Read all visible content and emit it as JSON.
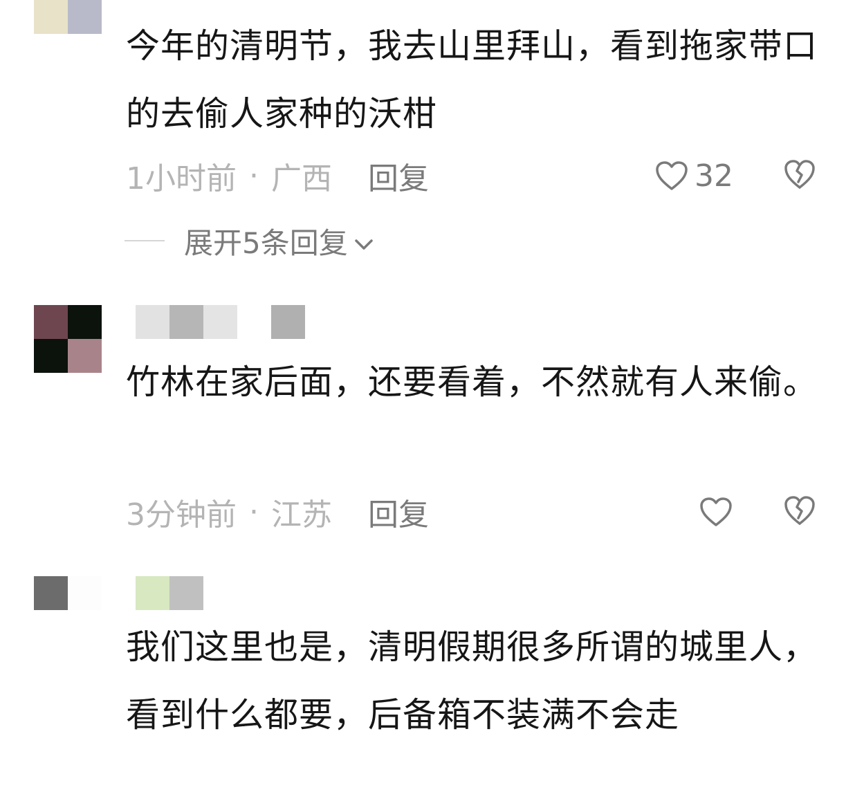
{
  "comments": [
    {
      "text": "今年的清明节，我去山里拜山，看到拖家带口的去偷人家种的沃柑",
      "time": "1小时前",
      "location": "广西",
      "reply_label": "回复",
      "like_count": "32",
      "expand_replies": "展开5条回复",
      "avatar_colors": [
        "#e8e2c8",
        "#b8bac9"
      ]
    },
    {
      "text": "竹林在家后面，还要看着，不然就有人来偷。",
      "time": "3分钟前",
      "location": "江苏",
      "reply_label": "回复",
      "like_count": "",
      "avatar_colors": [
        "#6e4650",
        "#0c120c",
        "#0c120c",
        "#a8848a"
      ],
      "username_colors": [
        "#e2e2e2",
        "#b6b6b6",
        "#e4e4e4",
        "#b0b0b0"
      ]
    },
    {
      "text": "我们这里也是，清明假期很多所谓的城里人，看到什么都要，后备箱不装满不会走",
      "avatar_colors": [
        "#6c6c6c",
        "#fdfdfd"
      ],
      "username_colors": [
        "#d8e8c0",
        "#c0c0c0"
      ]
    }
  ],
  "separator": "·",
  "icons": {
    "like": "heart-outline-icon",
    "dislike": "broken-heart-icon",
    "expand": "chevron-down-icon"
  },
  "colors": {
    "text": "#161616",
    "meta": "#b4b4b4",
    "action": "#7a7a7a"
  }
}
